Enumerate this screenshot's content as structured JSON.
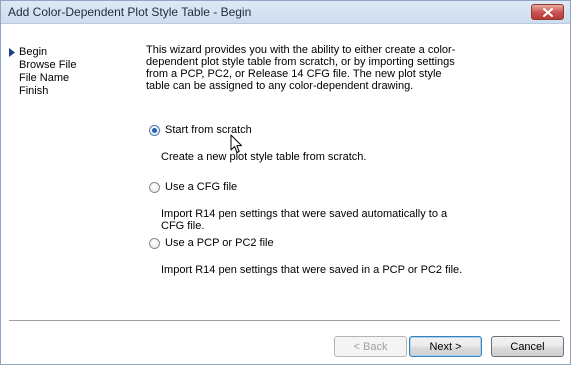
{
  "window": {
    "title": "Add Color-Dependent Plot Style Table - Begin"
  },
  "nav": {
    "items": [
      {
        "label": "Begin",
        "active": true
      },
      {
        "label": "Browse File",
        "active": false
      },
      {
        "label": "File Name",
        "active": false
      },
      {
        "label": "Finish",
        "active": false
      }
    ]
  },
  "intro_text": "This wizard provides you with the ability to either create a color-dependent plot style table from scratch, or by importing settings from a PCP, PC2, or Release 14 CFG file. The new plot style table can be assigned to any color-dependent drawing.",
  "options": [
    {
      "label": "Start from scratch",
      "description": "Create a new plot style table from scratch.",
      "selected": true
    },
    {
      "label": "Use a CFG file",
      "description": "Import R14 pen settings that were saved automatically to a CFG file.",
      "selected": false
    },
    {
      "label": "Use a PCP or PC2 file",
      "description": "Import R14 pen settings that were saved in a PCP or PC2 file.",
      "selected": false
    }
  ],
  "buttons": {
    "back": "< Back",
    "next": "Next >",
    "cancel": "Cancel"
  },
  "icons": {
    "close": "close-icon",
    "nav_arrow": "triangle-right-icon",
    "cursor": "mouse-pointer-icon"
  }
}
